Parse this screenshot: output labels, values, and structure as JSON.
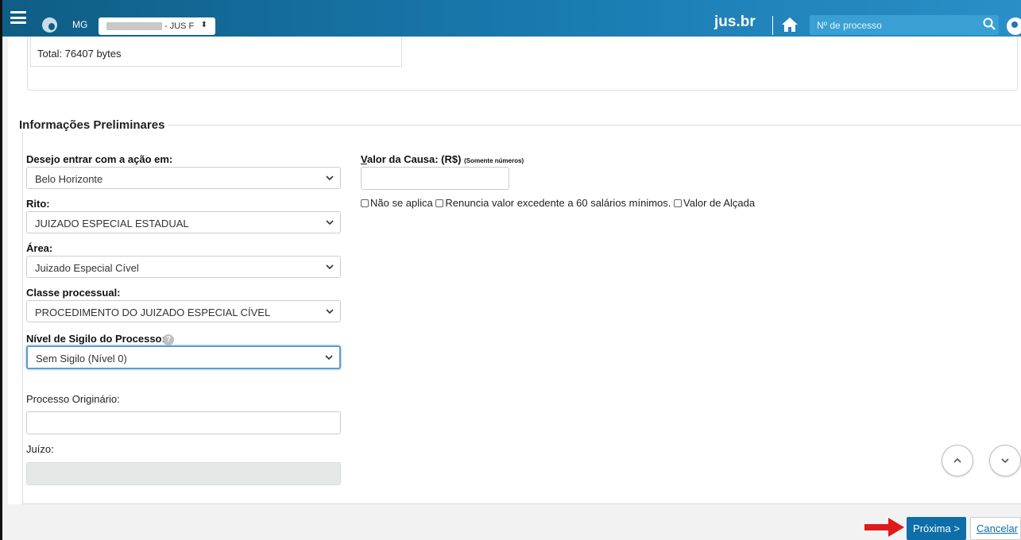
{
  "header": {
    "uf": "MG",
    "org_select_suffix": "- JUS F",
    "brand": "jus.br",
    "process_search_placeholder": "Nº de processo"
  },
  "upper": {
    "total_text": "Total: 76407 bytes"
  },
  "form": {
    "section_title": "Informações Preliminares",
    "acao_label": "Desejo entrar com a ação em:",
    "acao_value": "Belo Horizonte",
    "rito_label": "Rito:",
    "rito_value": "JUIZADO ESPECIAL ESTADUAL",
    "area_label": "Área:",
    "area_value": "Juizado Especial Cível",
    "classe_label": "Classe processual:",
    "classe_value": "PROCEDIMENTO DO JUIZADO ESPECIAL CÍVEL",
    "sigilo_label": "Nível de Sigilo do Processo:",
    "sigilo_value": "Sem Sigilo (Nível 0)",
    "help_icon_glyph": "?",
    "processo_originario_label": "Processo Originário:",
    "juizo_label": "Juízo:",
    "valor_label_underlined": "V",
    "valor_label_rest": "alor da Causa: (R$)",
    "valor_hint": "(Somente números)",
    "check_nao_se_aplica": "Não se aplica",
    "check_renuncia": "Renuncia valor excedente a 60 salários mínimos.",
    "check_alcada": "Valor de Alçada"
  },
  "actions": {
    "next_label": "Próxima >",
    "cancel_label": "Cancelar"
  },
  "colors": {
    "header_blue": "#1a7bb0",
    "button_blue": "#0d6ea8",
    "arrow_red": "#e0191b"
  }
}
